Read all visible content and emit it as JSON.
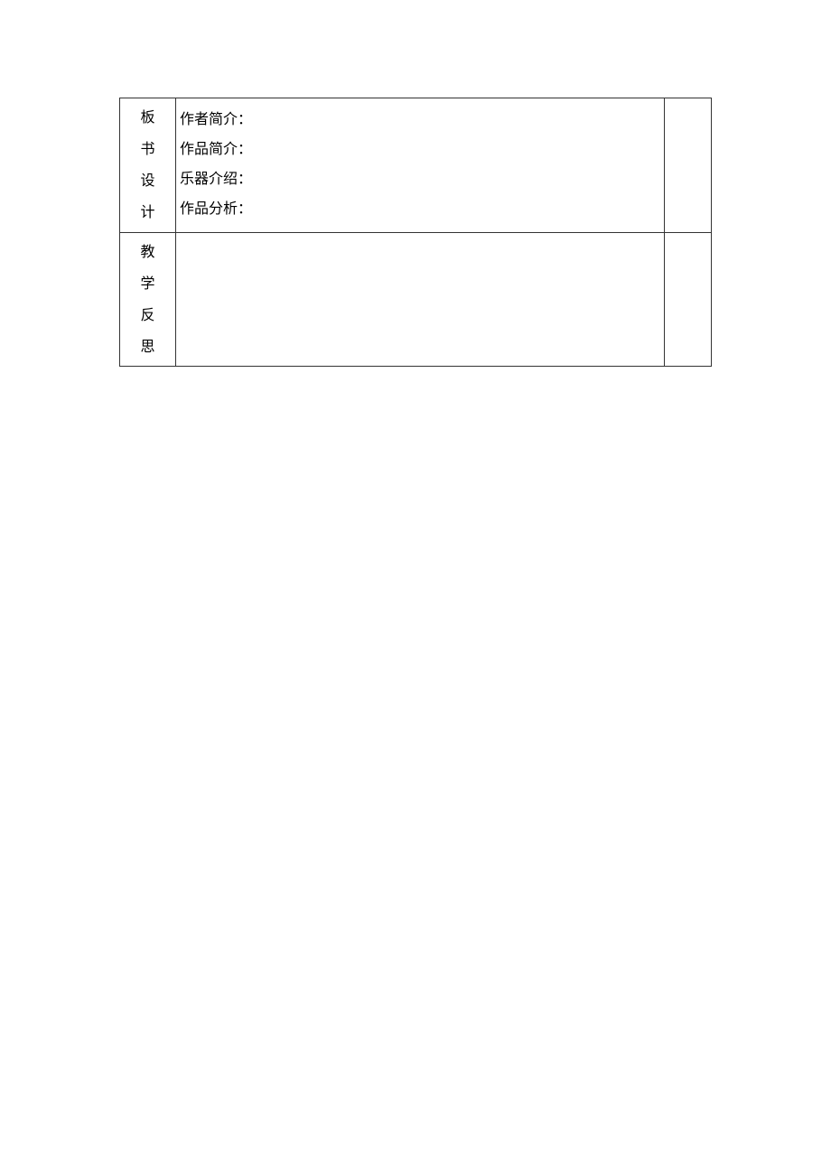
{
  "table": {
    "rows": [
      {
        "label_chars": [
          "板",
          "书",
          "设",
          "计"
        ],
        "content_lines": [
          "作者简介：",
          "作品简介：",
          "乐器介绍：",
          "作品分析："
        ],
        "side": ""
      },
      {
        "label_chars": [
          "教",
          "学",
          "反",
          "思"
        ],
        "content_lines": [],
        "side": ""
      }
    ]
  }
}
